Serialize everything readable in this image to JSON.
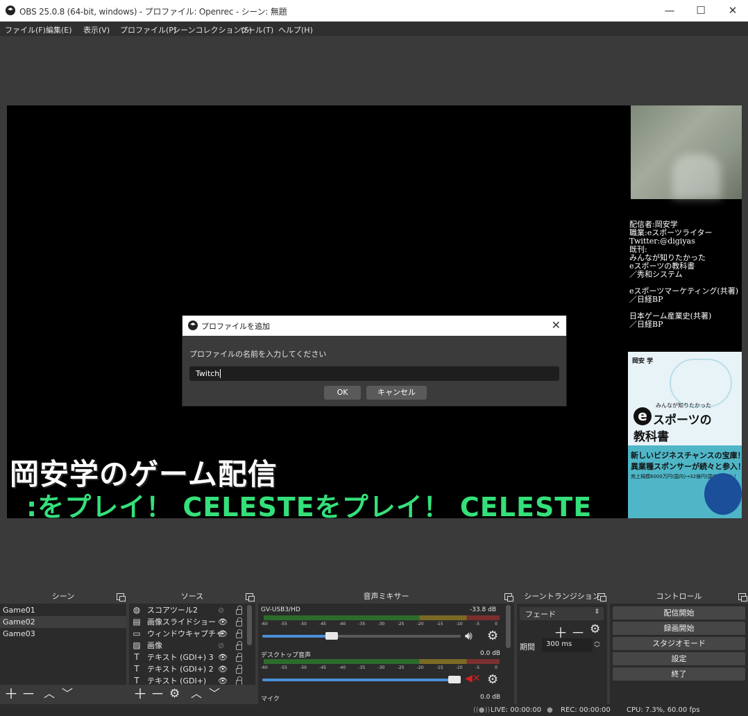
{
  "window": {
    "title": "OBS 25.0.8 (64-bit, windows) - プロファイル: Openrec - シーン: 無題",
    "minimize": "—",
    "maximize": "☐",
    "close": "✕"
  },
  "menu": [
    "ファイル(F)",
    "編集(E)",
    "表示(V)",
    "プロファイル(P)",
    "シーンコレクション(S)",
    "ツール(T)",
    "ヘルプ(H)"
  ],
  "preview": {
    "profile_text": "配信者:岡安学\n職業:eスポーツライター\nTwitter:@digiyas\n既刊:\nみんなが知りたかった\neスポーツの教科書\n／秀和システム\n\neスポーツマーケティング(共著)\n／日経BP\n\n日本ゲーム産業史(共著)\n／日経BP",
    "overlay_title": "岡安学のゲーム配信",
    "ticker": ":をプレイ！ CELESTEをプレイ！ CELESTE",
    "book": {
      "author": "岡安 学",
      "subtitle": "みんなが知りたかった",
      "e": "e",
      "title1": "スポーツの",
      "title2": "教科書",
      "band1": "新しいビジネスチャンスの宝庫！",
      "band2": "異業種スポンサーが続々と参入！",
      "band3": "売上規模6000万円(国内)→32億円(国内)大会も！"
    }
  },
  "dialog": {
    "title": "プロファイルを追加",
    "close": "✕",
    "prompt": "プロファイルの名前を入力してください",
    "input_value": "Twitch",
    "ok": "OK",
    "cancel": "キャンセル"
  },
  "scenes": {
    "header": "シーン",
    "items": [
      "Game01",
      "Game02",
      "Game03"
    ],
    "selected": "Game02"
  },
  "sources": {
    "header": "ソース",
    "items": [
      {
        "label": "スコアツール2",
        "icon": "globe-icon",
        "visible": false
      },
      {
        "label": "画像スライドショー",
        "icon": "slideshow-icon",
        "visible": true
      },
      {
        "label": "ウィンドウキャプチャ",
        "icon": "window-icon",
        "visible": true
      },
      {
        "label": "画像",
        "icon": "image-icon",
        "visible": false
      },
      {
        "label": "テキスト (GDI+) 3",
        "icon": "text-icon",
        "visible": true
      },
      {
        "label": "テキスト (GDI+) 2",
        "icon": "text-icon",
        "visible": true
      },
      {
        "label": "テキスト (GDI+)",
        "icon": "text-icon",
        "visible": true
      }
    ]
  },
  "mixer": {
    "header": "音声ミキサー",
    "channels": [
      {
        "name": "GV-USB3/HD",
        "db": "-33.8 dB",
        "volume": 0.35,
        "muted": false
      },
      {
        "name": "デスクトップ音声",
        "db": "0.0 dB",
        "volume": 1.0,
        "muted": true
      },
      {
        "name": "マイク",
        "db": "0.0 dB"
      }
    ],
    "ticks": [
      "-60",
      "-55",
      "-50",
      "-45",
      "-40",
      "-35",
      "-30",
      "-25",
      "-20",
      "-15",
      "-10",
      "-5",
      "0"
    ]
  },
  "transitions": {
    "header": "シーントランジション",
    "selected": "フェード",
    "duration_label": "期間",
    "duration_value": "300 ms"
  },
  "controls": {
    "header": "コントロール",
    "buttons": [
      "配信開始",
      "録画開始",
      "スタジオモード",
      "設定",
      "終了"
    ]
  },
  "status": {
    "live": "LIVE: 00:00:00",
    "rec": "REC: 00:00:00",
    "cpu": "CPU: 7.3%, 60.00 fps"
  },
  "colors": {
    "ticker": "#34e07a",
    "accent": "#4b8fd8",
    "mute": "#d22020"
  }
}
